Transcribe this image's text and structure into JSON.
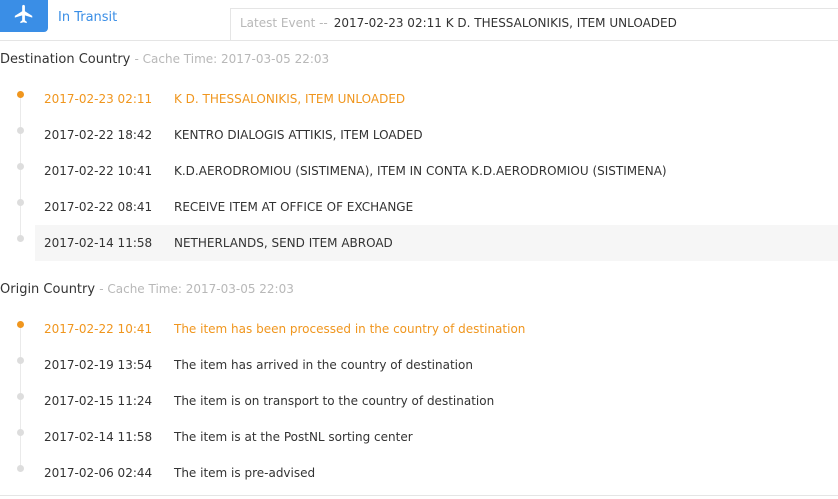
{
  "status": {
    "icon": "airplane-icon",
    "label": "In Transit",
    "accent_color": "#3a8ee6"
  },
  "latest_event": {
    "prefix": "Latest Event --",
    "text": "2017-02-23 02:11 K D. THESSALONIKIS, ITEM UNLOADED"
  },
  "destination": {
    "title": "Destination Country",
    "cache": "- Cache Time: 2017-03-05 22:03",
    "events": [
      {
        "time": "2017-02-23 02:11",
        "desc": "K D. THESSALONIKIS, ITEM UNLOADED",
        "active": true
      },
      {
        "time": "2017-02-22 18:42",
        "desc": "KENTRO DIALOGIS ATTIKIS, ITEM LOADED"
      },
      {
        "time": "2017-02-22 10:41",
        "desc": "K.D.AERODROMIOU (SISTIMENA), ITEM IN CONTA K.D.AERODROMIOU (SISTIMENA)"
      },
      {
        "time": "2017-02-22 08:41",
        "desc": "RECEIVE ITEM AT OFFICE OF EXCHANGE"
      },
      {
        "time": "2017-02-14 11:58",
        "desc": "NETHERLANDS, SEND ITEM ABROAD",
        "hover": true
      }
    ]
  },
  "origin": {
    "title": "Origin Country",
    "cache": "- Cache Time: 2017-03-05 22:03",
    "events": [
      {
        "time": "2017-02-22 10:41",
        "desc": "The item has been processed in the country of destination",
        "active": true
      },
      {
        "time": "2017-02-19 13:54",
        "desc": "The item has arrived in the country of destination"
      },
      {
        "time": "2017-02-15 11:24",
        "desc": "The item is on transport to the country of destination"
      },
      {
        "time": "2017-02-14 11:58",
        "desc": "The item is at the PostNL sorting center"
      },
      {
        "time": "2017-02-06 02:44",
        "desc": "The item is pre-advised"
      }
    ]
  },
  "colors": {
    "active": "#f0961e",
    "muted": "#b8b8b8"
  }
}
